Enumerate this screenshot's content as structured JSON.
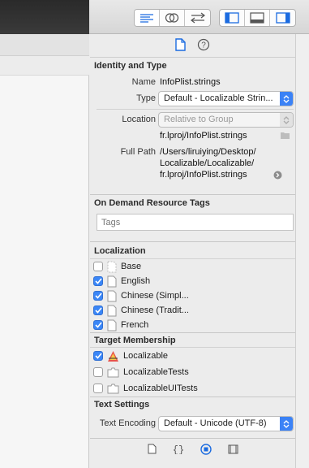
{
  "toolbar": {
    "editor_modes": [
      "standard-editor-icon",
      "assistant-editor-icon",
      "version-editor-icon"
    ],
    "panel_toggles": [
      "navigator-toggle-icon",
      "debug-area-toggle-icon",
      "utilities-toggle-icon"
    ]
  },
  "inspector_tabs": [
    "file-inspector-icon",
    "quick-help-icon"
  ],
  "identity": {
    "title": "Identity and Type",
    "name_label": "Name",
    "name_value": "InfoPlist.strings",
    "type_label": "Type",
    "type_value": "Default - Localizable Strin...",
    "location_label": "Location",
    "location_value": "Relative to Group",
    "location_path": "fr.lproj/InfoPlist.strings",
    "full_path_label": "Full Path",
    "full_path_lines": [
      "/Users/liruiying/Desktop/",
      "Localizable/Localizable/",
      "fr.lproj/InfoPlist.strings"
    ]
  },
  "on_demand": {
    "title": "On Demand Resource Tags",
    "placeholder": "Tags"
  },
  "localization": {
    "title": "Localization",
    "items": [
      {
        "label": "Base",
        "checked": false
      },
      {
        "label": "English",
        "checked": true
      },
      {
        "label": "Chinese (Simpl...",
        "checked": true
      },
      {
        "label": "Chinese (Tradit...",
        "checked": true
      },
      {
        "label": "French",
        "checked": true
      }
    ]
  },
  "target_membership": {
    "title": "Target Membership",
    "items": [
      {
        "label": "Localizable",
        "checked": true
      },
      {
        "label": "LocalizableTests",
        "checked": false
      },
      {
        "label": "LocalizableUITests",
        "checked": false
      }
    ]
  },
  "text_settings": {
    "title": "Text Settings",
    "encoding_label": "Text Encoding",
    "encoding_value": "Default - Unicode (UTF-8)"
  },
  "library_tabs": [
    "file-template-icon",
    "code-snippet-icon",
    "object-library-icon",
    "media-library-icon"
  ],
  "colors": {
    "accent": "#3a86f7"
  }
}
